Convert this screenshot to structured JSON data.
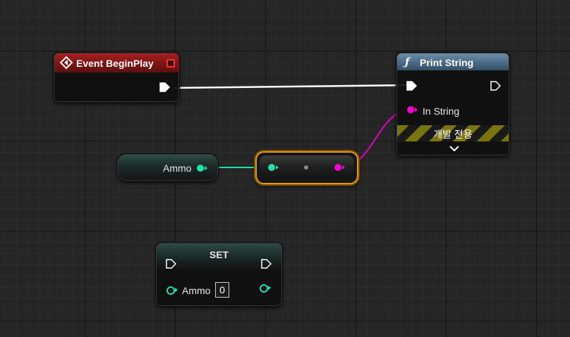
{
  "nodes": {
    "event_begin_play": {
      "title": "Event BeginPlay"
    },
    "print_string": {
      "title": "Print String",
      "pin_in_string": "In String",
      "dev_only": "개발 전용"
    },
    "ammo_getter": {
      "label": "Ammo"
    },
    "set_node": {
      "title": "SET",
      "pin_label": "Ammo",
      "value": "0"
    }
  },
  "colors": {
    "exec": "#ffffff",
    "integer": "#1ee0b0",
    "string": "#ff00d4",
    "event_header": "#8f1a1a",
    "function_header": "#4d6f8c",
    "reroute_highlight": "#e69a13"
  }
}
